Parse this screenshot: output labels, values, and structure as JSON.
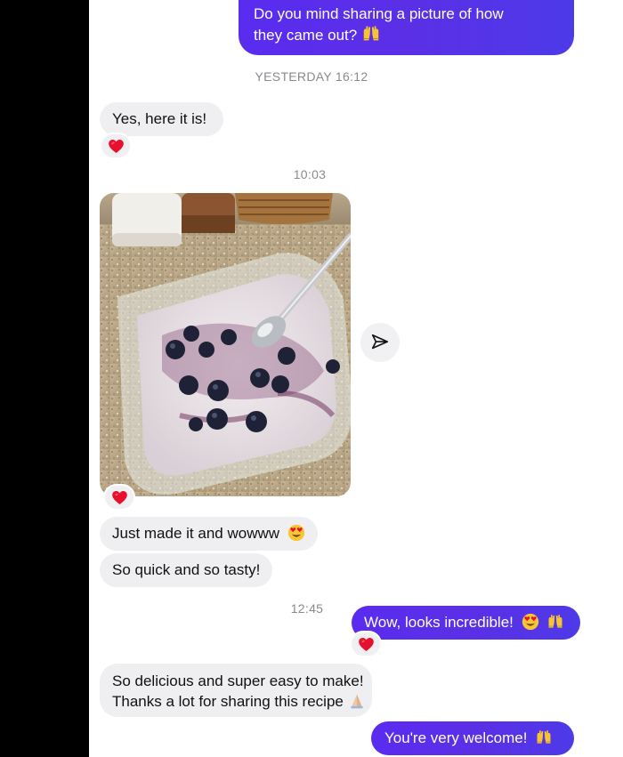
{
  "messages": {
    "m1": "Do you mind sharing a picture of how",
    "m1b": "they came out?",
    "ts1": "YESTERDAY 16:12",
    "m2": "Yes, here it is!",
    "ts2": "10:03",
    "m3": "Just made it and wowww",
    "m4": "So quick and so tasty!",
    "ts3": "12:45",
    "m5": "Wow, looks incredible!",
    "m6a": "So delicious and super easy to make!",
    "m6b": "Thanks a lot for sharing this recipe",
    "m7": "You're very welcome!"
  },
  "icons": {
    "reaction": "heart-icon",
    "share": "send-icon",
    "emoji_raised_hands": "raised-hands-icon",
    "emoji_heart_eyes": "heart-eyes-icon",
    "emoji_folded_hands": "folded-hands-icon"
  },
  "colors": {
    "outgoing_bubble": "#5a2cf0",
    "incoming_bubble": "#efeff2",
    "reaction_heart": "#e8112d"
  }
}
